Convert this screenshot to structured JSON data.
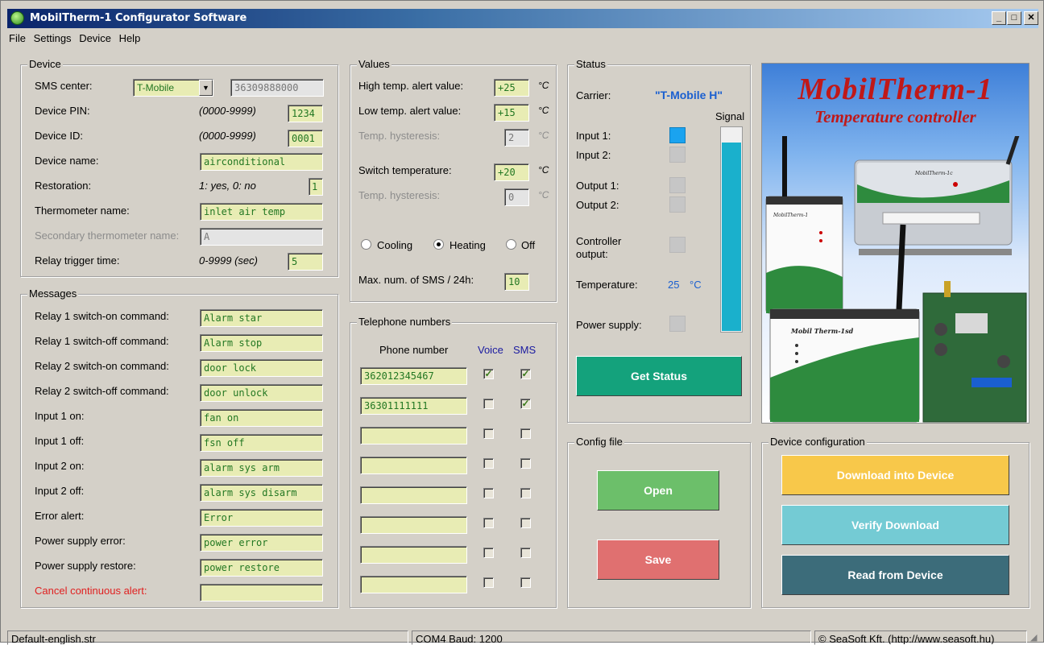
{
  "window": {
    "title": "MobilTherm-1 Configurator Software",
    "min": "_",
    "max": "□",
    "close": "✕"
  },
  "menu": [
    "File",
    "Settings",
    "Device",
    "Help"
  ],
  "device": {
    "group_label": "Device",
    "sms_center_label": "SMS center:",
    "sms_carrier": "T-Mobile",
    "sms_number": "36309888000",
    "pin_label": "Device PIN:",
    "pin_hint": "(0000-9999)",
    "pin_value": "1234",
    "id_label": "Device ID:",
    "id_hint": "(0000-9999)",
    "id_value": "0001",
    "name_label": "Device name:",
    "name_value": "airconditional",
    "restoration_label": "Restoration:",
    "restoration_hint": "1: yes, 0: no",
    "restoration_value": "1",
    "thermo_label": "Thermometer name:",
    "thermo_value": "inlet air temp",
    "sec_thermo_label": "Secondary thermometer name:",
    "sec_thermo_value": "A",
    "relay_label": "Relay trigger time:",
    "relay_hint": "0-9999 (sec)",
    "relay_value": "5"
  },
  "messages": {
    "group_label": "Messages",
    "items": [
      {
        "label": "Relay 1 switch-on command:",
        "value": "Alarm star"
      },
      {
        "label": "Relay 1 switch-off command:",
        "value": "Alarm stop"
      },
      {
        "label": "Relay 2 switch-on command:",
        "value": "door lock"
      },
      {
        "label": "Relay 2 switch-off command:",
        "value": "door  unlock"
      },
      {
        "label": "Input 1 on:",
        "value": "fan on"
      },
      {
        "label": "Input 1 off:",
        "value": "fsn off"
      },
      {
        "label": "Input 2 on:",
        "value": "alarm sys arm"
      },
      {
        "label": "Input 2 off:",
        "value": "alarm sys disarm"
      },
      {
        "label": "Error alert:",
        "value": "Error"
      },
      {
        "label": "Power supply error:",
        "value": "power error"
      },
      {
        "label": "Power supply restore:",
        "value": "power restore"
      },
      {
        "label": "Cancel continuous alert:",
        "value": ""
      }
    ],
    "alert_color": "#e02020"
  },
  "values": {
    "group_label": "Values",
    "high_label": "High temp. alert value:",
    "high_value": "+25",
    "low_label": "Low temp. alert value:",
    "low_value": "+15",
    "hyst1_label": "Temp. hysteresis:",
    "hyst1_value": "2",
    "switch_label": "Switch temperature:",
    "switch_value": "+20",
    "hyst2_label": "Temp. hysteresis:",
    "hyst2_value": "0",
    "unit": "°C",
    "mode_cooling": "Cooling",
    "mode_heating": "Heating",
    "mode_off": "Off",
    "mode_selected": "Heating",
    "maxsms_label": "Max. num. of SMS / 24h:",
    "maxsms_value": "10"
  },
  "phones": {
    "group_label": "Telephone numbers",
    "col_number": "Phone number",
    "col_voice": "Voice",
    "col_sms": "SMS",
    "header_color": "#1a1aa0",
    "rows": [
      {
        "number": "362012345467",
        "voice": true,
        "sms": true
      },
      {
        "number": "36301111111",
        "voice": false,
        "sms": true
      },
      {
        "number": "",
        "voice": false,
        "sms": false
      },
      {
        "number": "",
        "voice": false,
        "sms": false
      },
      {
        "number": "",
        "voice": false,
        "sms": false
      },
      {
        "number": "",
        "voice": false,
        "sms": false
      },
      {
        "number": "",
        "voice": false,
        "sms": false
      },
      {
        "number": "",
        "voice": false,
        "sms": false
      }
    ]
  },
  "status": {
    "group_label": "Status",
    "carrier_label": "Carrier:",
    "carrier_value": "\"T-Mobile H\"",
    "signal_label": "Signal",
    "signal_level": 0.93,
    "input1_label": "Input 1:",
    "input1_on": true,
    "input2_label": "Input 2:",
    "output1_label": "Output 1:",
    "output2_label": "Output 2:",
    "controller_label": "Controller output:",
    "temp_label": "Temperature:",
    "temp_value": "25",
    "temp_unit": "°C",
    "power_label": "Power supply:",
    "get_status": "Get Status",
    "accent": "#1a5fd0",
    "signal_color": "#1ab0cc"
  },
  "banner": {
    "title": "MobilTherm-1",
    "subtitle": "Temperature controller",
    "device_label_a": "MobilTherm-1",
    "device_label_b": "Mobil Therm-1sd",
    "device_label_c": "MobilTherm-1c",
    "title_color": "#c01818"
  },
  "config_file": {
    "group_label": "Config file",
    "open": "Open",
    "save": "Save"
  },
  "device_config": {
    "group_label": "Device configuration",
    "download": "Download into Device",
    "verify": "Verify Download",
    "read": "Read from Device"
  },
  "statusbar": {
    "file": "Default-english.str",
    "port": "COM4 Baud: 1200",
    "copyright": "© SeaSoft Kft. (http://www.seasoft.hu)"
  }
}
